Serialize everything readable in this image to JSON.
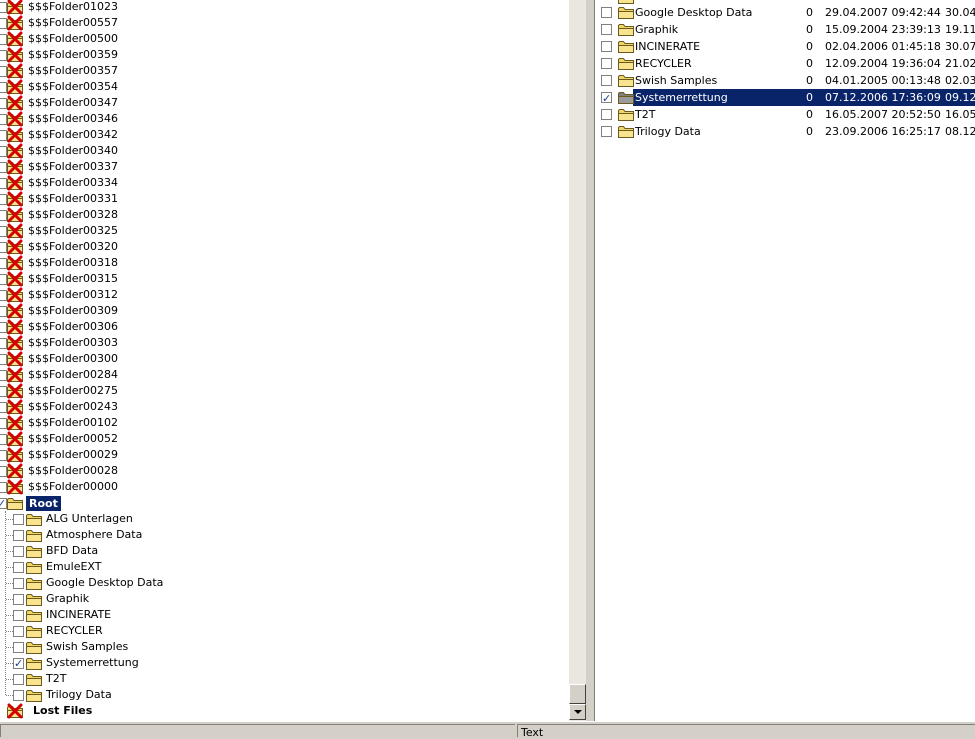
{
  "tree": {
    "deleted_folders": [
      "$$$Folder01023",
      "$$$Folder00557",
      "$$$Folder00500",
      "$$$Folder00359",
      "$$$Folder00357",
      "$$$Folder00354",
      "$$$Folder00347",
      "$$$Folder00346",
      "$$$Folder00342",
      "$$$Folder00340",
      "$$$Folder00337",
      "$$$Folder00334",
      "$$$Folder00331",
      "$$$Folder00328",
      "$$$Folder00325",
      "$$$Folder00320",
      "$$$Folder00318",
      "$$$Folder00315",
      "$$$Folder00312",
      "$$$Folder00309",
      "$$$Folder00306",
      "$$$Folder00303",
      "$$$Folder00300",
      "$$$Folder00284",
      "$$$Folder00275",
      "$$$Folder00243",
      "$$$Folder00102",
      "$$$Folder00052",
      "$$$Folder00029",
      "$$$Folder00028",
      "$$$Folder00000"
    ],
    "root_label": "Root",
    "root_children": [
      {
        "name": "ALG Unterlagen",
        "checked": false
      },
      {
        "name": "Atmosphere Data",
        "checked": false
      },
      {
        "name": "BFD Data",
        "checked": false
      },
      {
        "name": "EmuleEXT",
        "checked": false
      },
      {
        "name": "Google Desktop Data",
        "checked": false
      },
      {
        "name": "Graphik",
        "checked": false
      },
      {
        "name": "INCINERATE",
        "checked": false
      },
      {
        "name": "RECYCLER",
        "checked": false
      },
      {
        "name": "Swish Samples",
        "checked": false
      },
      {
        "name": "Systemerrettung",
        "checked": true
      },
      {
        "name": "T2T",
        "checked": false
      },
      {
        "name": "Trilogy Data",
        "checked": false
      }
    ],
    "lost_files_label": "Lost Files"
  },
  "list": {
    "rows": [
      {
        "name": "Google Desktop Data",
        "size": "0",
        "created": "29.04.2007 09:42:44",
        "modified": "30.04.",
        "checked": false,
        "selected": false
      },
      {
        "name": "Graphik",
        "size": "0",
        "created": "15.09.2004 23:39:13",
        "modified": "19.11.",
        "checked": false,
        "selected": false
      },
      {
        "name": "INCINERATE",
        "size": "0",
        "created": "02.04.2006 01:45:18",
        "modified": "30.07.",
        "checked": false,
        "selected": false
      },
      {
        "name": "RECYCLER",
        "size": "0",
        "created": "12.09.2004 19:36:04",
        "modified": "21.02.",
        "checked": false,
        "selected": false
      },
      {
        "name": "Swish Samples",
        "size": "0",
        "created": "04.01.2005 00:13:48",
        "modified": "02.03.",
        "checked": false,
        "selected": false
      },
      {
        "name": "Systemerrettung",
        "size": "0",
        "created": "07.12.2006 17:36:09",
        "modified": "09.12.",
        "checked": true,
        "selected": true
      },
      {
        "name": "T2T",
        "size": "0",
        "created": "16.05.2007 20:52:50",
        "modified": "16.05.",
        "checked": false,
        "selected": false
      },
      {
        "name": "Trilogy Data",
        "size": "0",
        "created": "23.09.2006 16:25:17",
        "modified": "08.12.",
        "checked": false,
        "selected": false
      }
    ]
  },
  "status": {
    "text": "Text"
  },
  "colors": {
    "selection": "#0a246a",
    "folder": "#f2d568",
    "folder_selected": "#7f7f7f",
    "delete_x": "#d40000"
  },
  "icons": {
    "deleted": "red-x-icon",
    "folder": "folder-icon"
  }
}
